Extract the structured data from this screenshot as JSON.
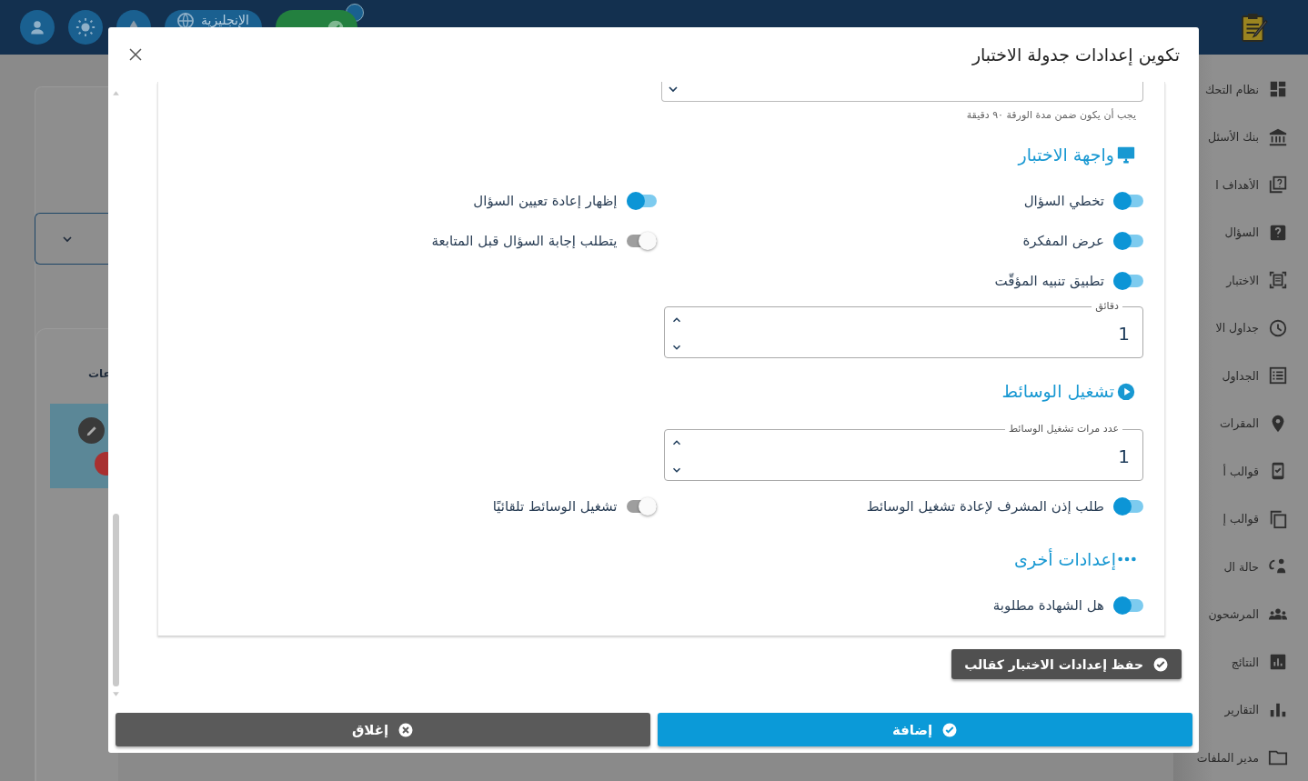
{
  "topbar": {
    "language_label": "الإنجليزية"
  },
  "sidebar": {
    "items": [
      {
        "label": "نظام التحك"
      },
      {
        "label": "بنك الأسئل"
      },
      {
        "label": "الأهداف ا"
      },
      {
        "label": "السؤال"
      },
      {
        "label": "الاختبار"
      },
      {
        "label": "جداول الا"
      },
      {
        "label": "الجداول"
      },
      {
        "label": "المقرات"
      },
      {
        "label": "قوالب أ"
      },
      {
        "label": "قوالب إ"
      },
      {
        "label": "حالة ال"
      },
      {
        "label": "المرشحون"
      },
      {
        "label": "النتائج"
      },
      {
        "label": "التقارير"
      },
      {
        "label": "مدير الملفات"
      }
    ]
  },
  "background": {
    "card_label": "عات"
  },
  "dialog": {
    "title": "تكوين إعدادات جدولة الاختبار",
    "duration_hint": "يجب أن يكون ضمن مدة الورقة ٩٠ دقيقة",
    "sections": [
      {
        "title": "واجهة الاختبار",
        "rows": [
          {
            "cells": [
              {
                "kind": "toggle",
                "label": "تخطي السؤال",
                "on": true
              },
              {
                "kind": "toggle",
                "label": "إظهار إعادة تعيين السؤال",
                "on": true
              }
            ]
          },
          {
            "cells": [
              {
                "kind": "toggle",
                "label": "عرض المفكرة",
                "on": true
              },
              {
                "kind": "toggle",
                "label": "يتطلب إجابة السؤال قبل المتابعة",
                "on": false
              }
            ]
          },
          {
            "cells": [
              {
                "kind": "toggle",
                "label": "تطبيق تنبيه المؤقّت",
                "on": true
              }
            ]
          },
          {
            "cells": [
              {
                "kind": "number",
                "label": "دقائق",
                "value": "1"
              }
            ]
          }
        ]
      },
      {
        "title": "تشغيل الوسائط",
        "rows": [
          {
            "cells": [
              {
                "kind": "number",
                "label": "عدد مرات تشغيل الوسائط",
                "value": "1"
              }
            ]
          },
          {
            "cells": [
              {
                "kind": "toggle",
                "label": "طلب إذن المشرف لإعادة تشغيل الوسائط",
                "on": true
              },
              {
                "kind": "toggle",
                "label": "تشغيل الوسائط تلقائيًا",
                "on": false
              }
            ]
          }
        ]
      },
      {
        "title": "إعدادات أخرى",
        "rows": [
          {
            "cells": [
              {
                "kind": "toggle",
                "label": "هل الشهادة مطلوبة",
                "on": true
              }
            ]
          }
        ]
      }
    ],
    "save_template_button": "حفظ إعدادات الاختبار كقالب",
    "buttons": [
      {
        "kind": "primary",
        "label": "إضافة"
      },
      {
        "kind": "secondary",
        "label": "إغلاق"
      }
    ]
  }
}
